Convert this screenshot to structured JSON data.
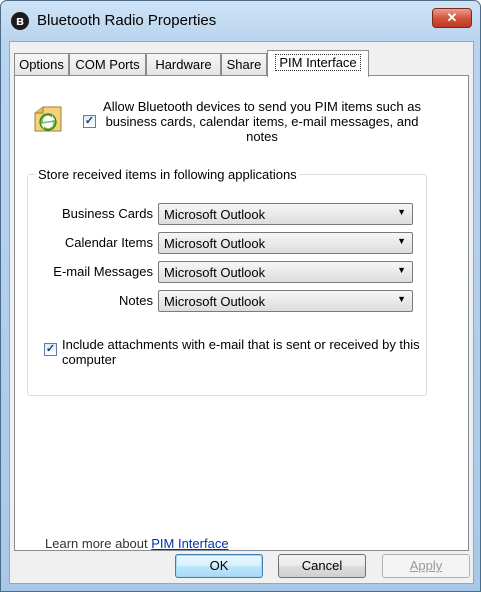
{
  "window": {
    "title": "Bluetooth Radio Properties",
    "close_glyph": "✕"
  },
  "tabs": [
    {
      "label": "Options"
    },
    {
      "label": "COM Ports"
    },
    {
      "label": "Hardware"
    },
    {
      "label": "Share"
    },
    {
      "label": "PIM Interface"
    }
  ],
  "pim": {
    "allow_label": "Allow Bluetooth devices to send you PIM items such as business cards, calendar items, e-mail messages, and notes",
    "allow_checked": true,
    "group_label": "Store received items in following applications",
    "rows": [
      {
        "label": "Business Cards",
        "value": "Microsoft Outlook"
      },
      {
        "label": "Calendar Items",
        "value": "Microsoft Outlook"
      },
      {
        "label": "E-mail Messages",
        "value": "Microsoft Outlook"
      },
      {
        "label": "Notes",
        "value": "Microsoft Outlook"
      }
    ],
    "attach_label": "Include attachments with e-mail that is sent or received by this computer",
    "attach_checked": true,
    "learn_prefix": "Learn more about ",
    "learn_link": "PIM Interface"
  },
  "buttons": {
    "ok": "OK",
    "cancel": "Cancel",
    "apply": "Apply"
  },
  "icons": {
    "title": "bluetooth-icon",
    "pim": "pim-sync-icon",
    "dropdown": "chevron-down-icon"
  }
}
